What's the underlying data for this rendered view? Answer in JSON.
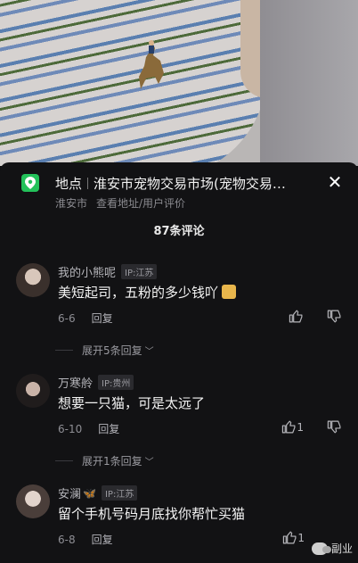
{
  "location": {
    "label": "地点",
    "name": "淮安市宠物交易市场(宠物交易…",
    "city": "淮安市",
    "action": "查看地址/用户评价"
  },
  "comments_count": "87条评论",
  "comments": [
    {
      "user": "我的小熊呢",
      "ip": "IP:江苏",
      "text": "美短起司，五粉的多少钱吖",
      "date": "6-6",
      "reply": "回复",
      "likes": "",
      "expand": "展开5条回复"
    },
    {
      "user": "万寒舲",
      "ip": "IP:贵州",
      "text": "想要一只猫，可是太远了",
      "date": "6-10",
      "reply": "回复",
      "likes": "1",
      "expand": "展开1条回复"
    },
    {
      "user": "安澜",
      "ip": "IP:江苏",
      "text": "留个手机号码月底找你帮忙买猫",
      "date": "6-8",
      "reply": "回复",
      "likes": "1",
      "expand": ""
    }
  ],
  "watermark": "副业",
  "icons": {
    "location": "map-pin-icon",
    "close": "close-icon",
    "like": "thumbs-up-icon",
    "dislike": "thumbs-down-icon"
  },
  "colors": {
    "accent": "#23c15a",
    "background": "#121214"
  }
}
